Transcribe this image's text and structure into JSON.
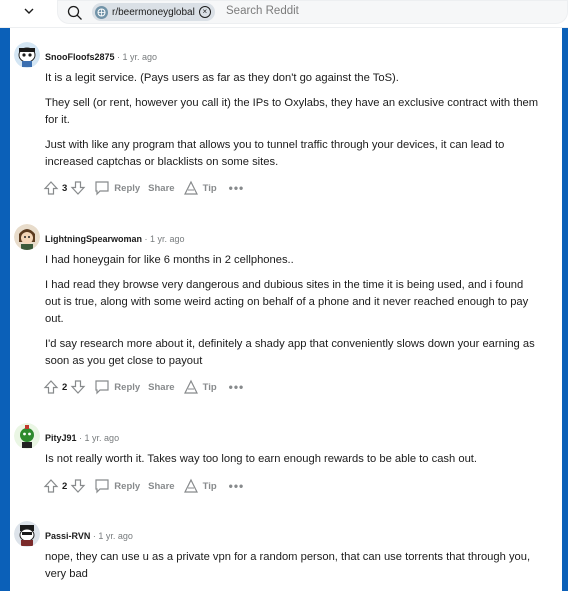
{
  "topbar": {
    "subreddit_chip": "r/beermoneyglobal",
    "search_placeholder": "Search Reddit"
  },
  "actions_labels": {
    "reply": "Reply",
    "share": "Share",
    "tip": "Tip",
    "more": "•••"
  },
  "comments": [
    {
      "username": "SnooFloofs2875",
      "time": "1 yr. ago",
      "paragraphs": [
        "It is a legit service. (Pays users as far as they don't go against the ToS).",
        "They sell (or rent, however you call it) the IPs to Oxylabs, they have an exclusive contract with them for it.",
        "Just with like any program that allows you to tunnel traffic through your devices, it can lead to increased captchas or blacklists on some sites."
      ],
      "score": "3"
    },
    {
      "username": "LightningSpearwoman",
      "time": "1 yr. ago",
      "paragraphs": [
        "I had honeygain for like 6 months in 2 cellphones..",
        "I had read they browse very dangerous and dubious sites in the time it is being used, and i found out is true, along with some weird acting on behalf of a phone and it never reached enough to pay out.",
        "I'd say research more about it, definitely a shady app that conveniently slows down your earning as soon as you get close to payout"
      ],
      "score": "2"
    },
    {
      "username": "PityJ91",
      "time": "1 yr. ago",
      "paragraphs": [
        "Is not really worth it. Takes way too long to earn enough rewards to be able to cash out."
      ],
      "score": "2"
    },
    {
      "username": "Passi-RVN",
      "time": "1 yr. ago",
      "paragraphs": [
        "nope, they can use u as a private vpn for a random person, that can use torrents that through you, very bad"
      ]
    }
  ],
  "colors": {
    "rail": "#0b60b8",
    "meta": "#787c7e",
    "action": "#878a8c"
  }
}
